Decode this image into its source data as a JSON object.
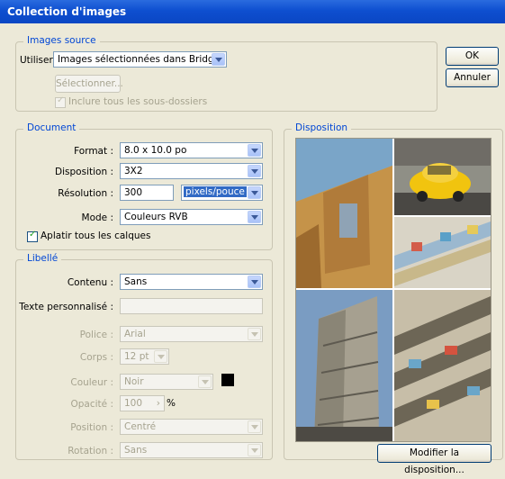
{
  "window": {
    "title": "Collection d'images"
  },
  "images_source": {
    "legend": "Images source",
    "use_label": "Utiliser :",
    "use_value": "Images sélectionnées dans Bridge",
    "select_button": "Sélectionner...",
    "include_subfolders": "Inclure tous les sous-dossiers"
  },
  "buttons": {
    "ok": "OK",
    "cancel": "Annuler",
    "modify_layout": "Modifier la disposition..."
  },
  "document": {
    "legend": "Document",
    "format_label": "Format :",
    "format_value": "8.0 x 10.0 po",
    "layout_label": "Disposition :",
    "layout_value": "3X2",
    "resolution_label": "Résolution :",
    "resolution_value": "300",
    "resolution_unit": "pixels/pouce",
    "mode_label": "Mode :",
    "mode_value": "Couleurs RVB",
    "flatten_label": "Aplatir tous les calques"
  },
  "caption": {
    "legend": "Libellé",
    "content_label": "Contenu :",
    "content_value": "Sans",
    "custom_text_label": "Texte personnalisé :",
    "font_label": "Police :",
    "font_value": "Arial",
    "size_label": "Corps :",
    "size_value": "12 pt",
    "color_label": "Couleur :",
    "color_value": "Noir",
    "opacity_label": "Opacité :",
    "opacity_value": "100",
    "opacity_unit": "%",
    "position_label": "Position :",
    "position_value": "Centré",
    "rotation_label": "Rotation :",
    "rotation_value": "Sans"
  },
  "layout_panel": {
    "legend": "Disposition"
  },
  "colors": {
    "accent": "#0046d5",
    "titlebar": "#0a46c3",
    "swatch": "#000000"
  }
}
